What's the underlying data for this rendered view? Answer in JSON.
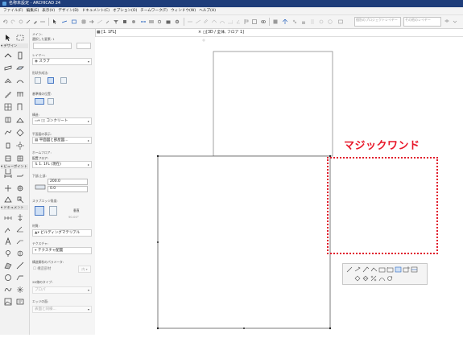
{
  "window": {
    "title": "名称未設定 - ARCHICAD 24"
  },
  "menu": [
    "ファイル(F)",
    "編集(E)",
    "表示(V)",
    "デザイン(D)",
    "ドキュメント(C)",
    "オプション(O)",
    "チームワーク(T)",
    "ウィンドウ(W)",
    "ヘルプ(H)"
  ],
  "toolbar": {
    "layer_combo_1": "個別のプロジェクトレイヤー",
    "layer_combo_2": "その他のレイヤー"
  },
  "tabs": {
    "floor_plan": "[1. 1FL]",
    "view3d": "[3D / 全体, フロア 1]"
  },
  "toolbox": {
    "select_label": "矢印",
    "design": "デザイン",
    "viewpoint": "ビューポイント",
    "document": "ドキュメント"
  },
  "infobox": {
    "main_label": "メイン:",
    "selected_count_label": "選択した要素: 1",
    "layer_label": "レイヤー:",
    "layer_value": "スラブ",
    "geometry_label": "形状作成法:",
    "ref_line_label": "基準線の位置:",
    "structure_label": "構造:",
    "structure_value": "コンクリート",
    "floor_plan_display_label": "平面図の表示:",
    "floor_plan_display_value": "平面図と部屋図...",
    "home_story_label": "ホームフロア:",
    "story_label": "配置フロア:",
    "story_value": "1. 1FL (現在)",
    "top_offset_label": "下部/上部:",
    "top_value": "200.0",
    "bottom_value": "0.0",
    "slope_label": "スラブエッジ角度:",
    "slope_mode": "垂直",
    "slope_angle": "90.00°",
    "material_label": "材質:",
    "material_value": "ビルディングマテリアル",
    "texture_label": "テクスチャ:",
    "texture_value": "テクスチャ配置",
    "section_props_label": "構造解析のパラメータ:",
    "structural_function": "構造部材",
    "structural_function_badge": "内",
    "line_type_label": "2D線のタイプ:",
    "line_type_value": "プロパ",
    "edge_surface_label": "エッジの面:",
    "edge_surface_value": "表面と同様..."
  },
  "annotation": {
    "magic_wand_label": "マジックワンド",
    "color": "#e01c2c"
  }
}
